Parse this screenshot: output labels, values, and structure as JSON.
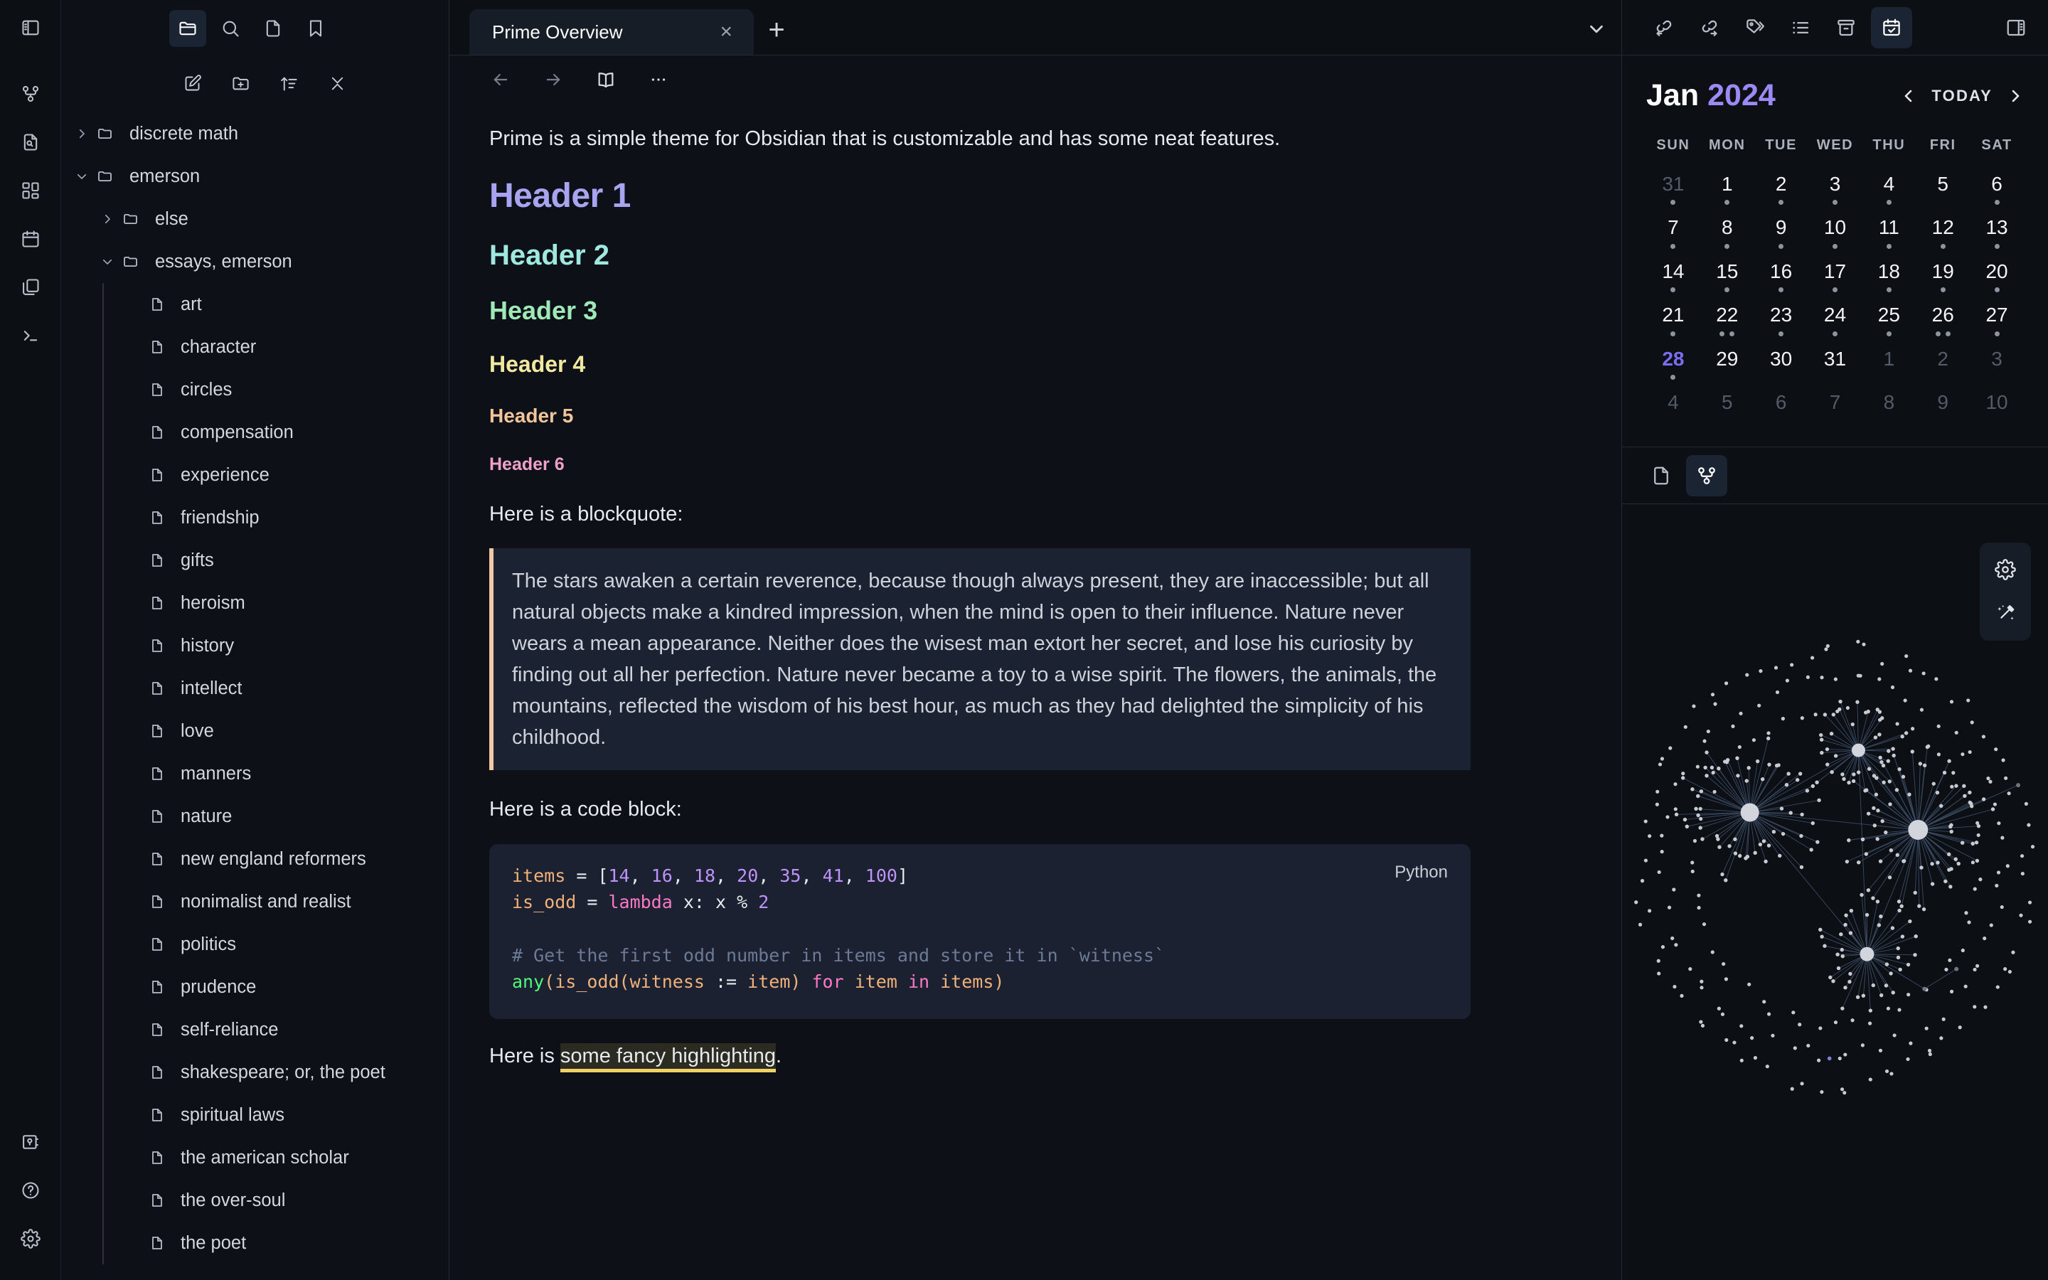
{
  "ribbon": {
    "top_icon": "sidebar-toggle-icon",
    "mid_icons": [
      "graph-view-icon",
      "file-search-icon",
      "canvas-icon",
      "daily-note-icon",
      "workspaces-icon",
      "terminal-icon"
    ],
    "bottom_icons": [
      "vault-icon",
      "help-icon",
      "settings-icon"
    ]
  },
  "explorer": {
    "tabs": [
      "folder-icon",
      "search-icon",
      "file-icon",
      "bookmark-icon"
    ],
    "tools": [
      "new-note-icon",
      "new-folder-icon",
      "sort-icon",
      "collapse-all-icon"
    ],
    "tree": [
      {
        "label": "discrete math",
        "type": "folder",
        "depth": 0,
        "expanded": false
      },
      {
        "label": "emerson",
        "type": "folder",
        "depth": 0,
        "expanded": true
      },
      {
        "label": "else",
        "type": "folder",
        "depth": 1,
        "expanded": false
      },
      {
        "label": "essays, emerson",
        "type": "folder",
        "depth": 1,
        "expanded": true
      },
      {
        "label": "art",
        "type": "file",
        "depth": 2
      },
      {
        "label": "character",
        "type": "file",
        "depth": 2
      },
      {
        "label": "circles",
        "type": "file",
        "depth": 2
      },
      {
        "label": "compensation",
        "type": "file",
        "depth": 2
      },
      {
        "label": "experience",
        "type": "file",
        "depth": 2
      },
      {
        "label": "friendship",
        "type": "file",
        "depth": 2
      },
      {
        "label": "gifts",
        "type": "file",
        "depth": 2
      },
      {
        "label": "heroism",
        "type": "file",
        "depth": 2
      },
      {
        "label": "history",
        "type": "file",
        "depth": 2
      },
      {
        "label": "intellect",
        "type": "file",
        "depth": 2
      },
      {
        "label": "love",
        "type": "file",
        "depth": 2
      },
      {
        "label": "manners",
        "type": "file",
        "depth": 2
      },
      {
        "label": "nature",
        "type": "file",
        "depth": 2
      },
      {
        "label": "new england reformers",
        "type": "file",
        "depth": 2
      },
      {
        "label": "nonimalist and realist",
        "type": "file",
        "depth": 2
      },
      {
        "label": "politics",
        "type": "file",
        "depth": 2
      },
      {
        "label": "prudence",
        "type": "file",
        "depth": 2
      },
      {
        "label": "self-reliance",
        "type": "file",
        "depth": 2
      },
      {
        "label": "shakespeare; or, the poet",
        "type": "file",
        "depth": 2
      },
      {
        "label": "spiritual laws",
        "type": "file",
        "depth": 2
      },
      {
        "label": "the american scholar",
        "type": "file",
        "depth": 2
      },
      {
        "label": "the over-soul",
        "type": "file",
        "depth": 2
      },
      {
        "label": "the poet",
        "type": "file",
        "depth": 2
      }
    ]
  },
  "main": {
    "tab_title": "Prime Overview",
    "tab_close": "×",
    "tab_add": "+",
    "viewbar_icons": [
      "back-arrow-icon",
      "forward-arrow-icon",
      "reading-view-icon",
      "more-options-icon"
    ],
    "intro": "Prime is a simple theme for Obsidian that is customizable and has some neat features.",
    "headers": [
      {
        "level": 1,
        "text": "Header 1",
        "color": "#a8a4f0"
      },
      {
        "level": 2,
        "text": "Header 2",
        "color": "#9ee8e0"
      },
      {
        "level": 3,
        "text": "Header 3",
        "color": "#9fe8b8"
      },
      {
        "level": 4,
        "text": "Header 4",
        "color": "#f2e9a0"
      },
      {
        "level": 5,
        "text": "Header 5",
        "color": "#f2c49a"
      },
      {
        "level": 6,
        "text": "Header 6",
        "color": "#f0a0c8"
      }
    ],
    "blockquote_intro": "Here is a blockquote:",
    "blockquote": "The stars awaken a certain reverence, because though always present, they are inaccessible; but all natural objects make a kindred impression, when the mind is open to their influence. Nature never wears a mean appearance. Neither does the wisest man extort her secret, and lose his curiosity by finding out all her perfection. Nature never became a toy to a wise spirit. The flowers, the animals, the mountains, reflected the wisdom of his best hour, as much as they had delighted the simplicity of his childhood.",
    "code_intro": "Here is a code block:",
    "code_lang": "Python",
    "code": {
      "line1": {
        "var": "items",
        "op": " = [",
        "nums": [
          "14",
          "16",
          "18",
          "20",
          "35",
          "41",
          "100"
        ],
        "close": "]"
      },
      "line2_var": "is_odd",
      "line2_eq": " = ",
      "line2_kw": "lambda",
      "line2_rest": " x: x % ",
      "line2_num": "2",
      "comment": "# Get the first odd number in items and store it in `witness`",
      "line4_fn": "any",
      "line4_p1": "(",
      "line4_v1": "is_odd",
      "line4_p2": "(",
      "line4_v2": "witness",
      "line4_op": " := ",
      "line4_v3": "item",
      "line4_p3": ") ",
      "line4_kw1": "for",
      "line4_v4": " item ",
      "line4_kw2": "in",
      "line4_v5": " items",
      "line4_p4": ")"
    },
    "highlight_prefix": "Here is ",
    "highlight_text": "some fancy highlighting",
    "highlight_suffix": "."
  },
  "rightbar": {
    "top_icons": [
      "backlinks-icon",
      "outgoing-links-icon",
      "tags-icon",
      "outline-icon",
      "archive-icon",
      "calendar-icon"
    ],
    "panel_toggle_icon": "right-sidebar-toggle-icon",
    "calendar": {
      "month": "Jan",
      "year": "2024",
      "today_label": "TODAY",
      "prev_icon": "chevron-left-icon",
      "next_icon": "chevron-right-icon",
      "dow": [
        "SUN",
        "MON",
        "TUE",
        "WED",
        "THU",
        "FRI",
        "SAT"
      ],
      "weeks": [
        [
          {
            "n": "31",
            "dim": true,
            "dots": 1
          },
          {
            "n": "1",
            "dim": false,
            "dots": 1
          },
          {
            "n": "2",
            "dim": false,
            "dots": 1
          },
          {
            "n": "3",
            "dim": false,
            "dots": 1
          },
          {
            "n": "4",
            "dim": false,
            "dots": 1
          },
          {
            "n": "5",
            "dim": false,
            "dots": 0
          },
          {
            "n": "6",
            "dim": false,
            "dots": 1
          }
        ],
        [
          {
            "n": "7",
            "dim": false,
            "dots": 1
          },
          {
            "n": "8",
            "dim": false,
            "dots": 1
          },
          {
            "n": "9",
            "dim": false,
            "dots": 1
          },
          {
            "n": "10",
            "dim": false,
            "dots": 1
          },
          {
            "n": "11",
            "dim": false,
            "dots": 1
          },
          {
            "n": "12",
            "dim": false,
            "dots": 1
          },
          {
            "n": "13",
            "dim": false,
            "dots": 1
          }
        ],
        [
          {
            "n": "14",
            "dim": false,
            "dots": 1
          },
          {
            "n": "15",
            "dim": false,
            "dots": 1
          },
          {
            "n": "16",
            "dim": false,
            "dots": 1
          },
          {
            "n": "17",
            "dim": false,
            "dots": 1
          },
          {
            "n": "18",
            "dim": false,
            "dots": 1
          },
          {
            "n": "19",
            "dim": false,
            "dots": 1
          },
          {
            "n": "20",
            "dim": false,
            "dots": 1
          }
        ],
        [
          {
            "n": "21",
            "dim": false,
            "dots": 1
          },
          {
            "n": "22",
            "dim": false,
            "dots": 2
          },
          {
            "n": "23",
            "dim": false,
            "dots": 1
          },
          {
            "n": "24",
            "dim": false,
            "dots": 1
          },
          {
            "n": "25",
            "dim": false,
            "dots": 1
          },
          {
            "n": "26",
            "dim": false,
            "dots": 2
          },
          {
            "n": "27",
            "dim": false,
            "dots": 1
          }
        ],
        [
          {
            "n": "28",
            "dim": false,
            "dots": 1,
            "today": true
          },
          {
            "n": "29",
            "dim": false,
            "dots": 0
          },
          {
            "n": "30",
            "dim": false,
            "dots": 0
          },
          {
            "n": "31",
            "dim": false,
            "dots": 0
          },
          {
            "n": "1",
            "dim": true,
            "dots": 0
          },
          {
            "n": "2",
            "dim": true,
            "dots": 0
          },
          {
            "n": "3",
            "dim": true,
            "dots": 0
          }
        ],
        [
          {
            "n": "4",
            "dim": true,
            "dots": 0
          },
          {
            "n": "5",
            "dim": true,
            "dots": 0
          },
          {
            "n": "6",
            "dim": true,
            "dots": 0
          },
          {
            "n": "7",
            "dim": true,
            "dots": 0
          },
          {
            "n": "8",
            "dim": true,
            "dots": 0
          },
          {
            "n": "9",
            "dim": true,
            "dots": 0
          },
          {
            "n": "10",
            "dim": true,
            "dots": 0
          }
        ]
      ]
    },
    "graph": {
      "tabs": [
        "local-file-icon",
        "graph-view-icon"
      ],
      "tools": [
        "gear-icon",
        "magic-wand-icon"
      ],
      "hubs": [
        {
          "cx": 0.3,
          "cy": 0.34,
          "r": 13,
          "leaves": 62,
          "spread": 0.175
        },
        {
          "cx": 0.555,
          "cy": 0.215,
          "r": 9.5,
          "leaves": 38,
          "spread": 0.125
        },
        {
          "cx": 0.695,
          "cy": 0.375,
          "r": 14,
          "leaves": 72,
          "spread": 0.195
        },
        {
          "cx": 0.575,
          "cy": 0.625,
          "r": 10,
          "leaves": 42,
          "spread": 0.135
        }
      ],
      "orphan_rings": [
        {
          "cx": 0.5,
          "cy": 0.45,
          "rx": 0.455,
          "ry": 0.435,
          "count": 78
        },
        {
          "cx": 0.5,
          "cy": 0.45,
          "rx": 0.395,
          "ry": 0.375,
          "count": 66
        },
        {
          "cx": 0.5,
          "cy": 0.45,
          "rx": 0.335,
          "ry": 0.315,
          "count": 54
        }
      ]
    }
  }
}
